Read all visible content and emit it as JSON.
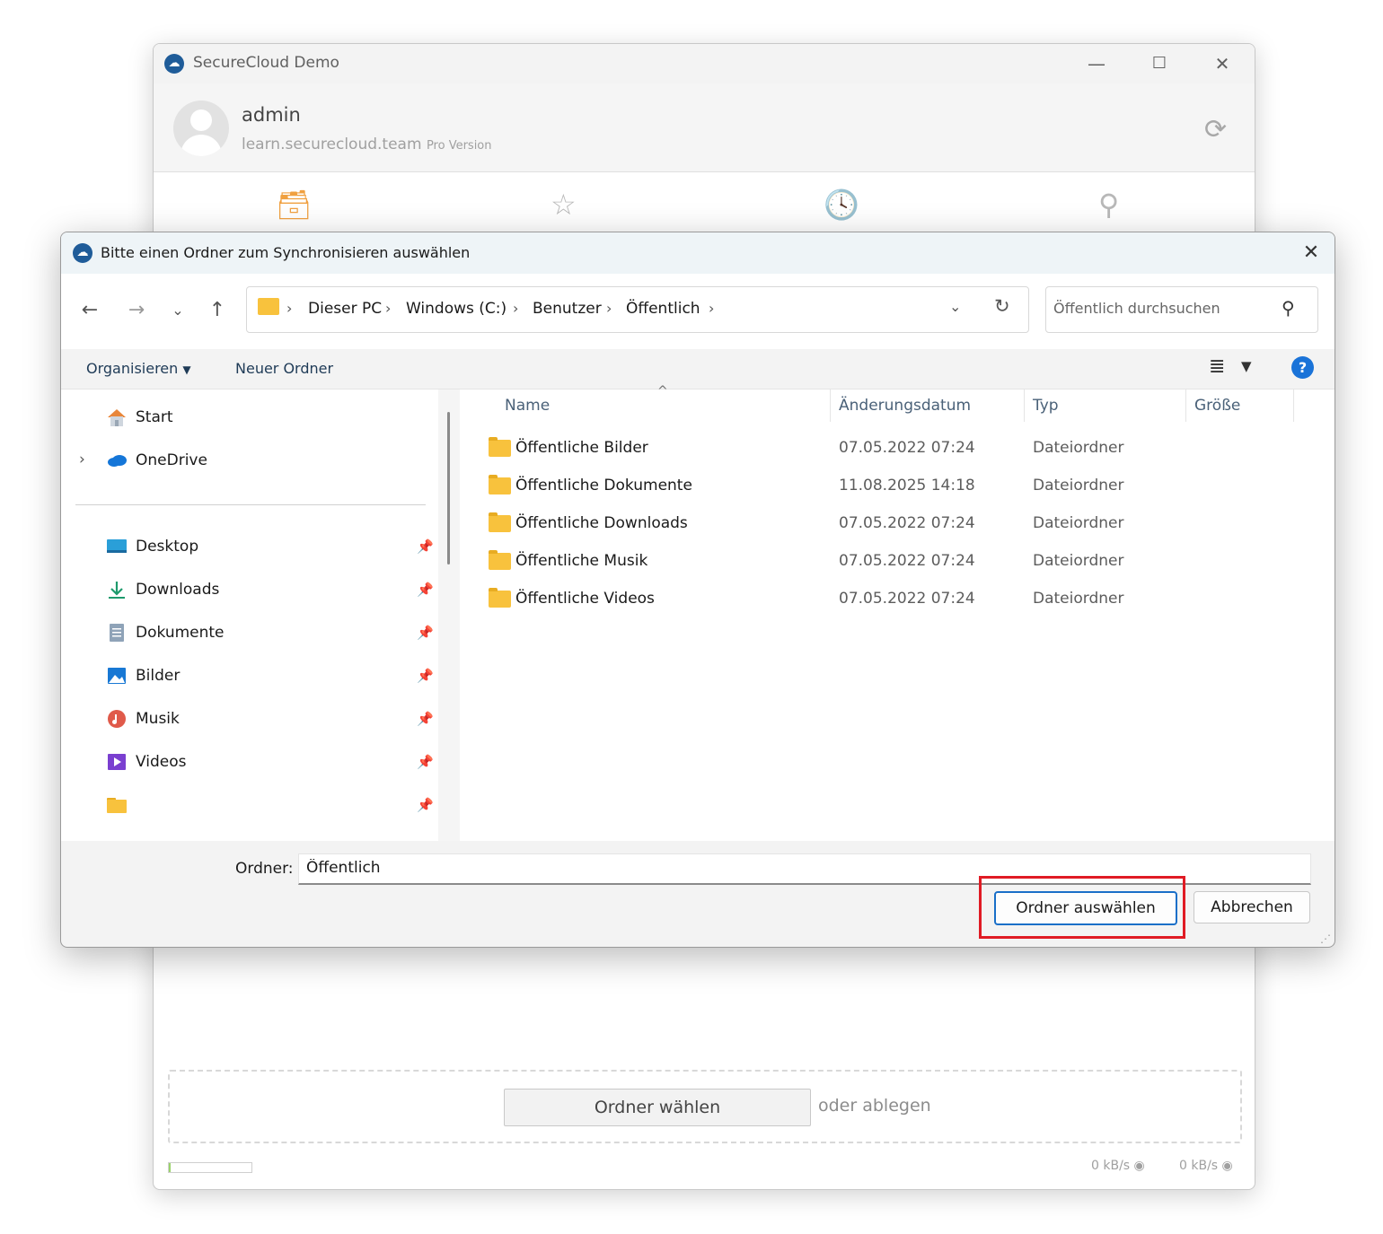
{
  "app": {
    "title": "SecureCloud Demo",
    "logo": "securecloud-logo",
    "window_controls": {
      "minimize": "—",
      "maximize": "☐",
      "close": "✕"
    },
    "user": {
      "name": "admin",
      "server": "learn.securecloud.team",
      "edition": "Pro Version"
    },
    "sync_icon": "sync-icon",
    "tabs": [
      "inbox-icon",
      "star-icon",
      "history-icon",
      "search-icon"
    ],
    "dropzone": {
      "button_label": "Ordner wählen",
      "drop_label": "oder ablegen"
    },
    "progress_fraction": 0.02,
    "speeds": {
      "upload": "0 kB/s",
      "download": "0 kB/s"
    }
  },
  "dialog": {
    "title": "Bitte einen Ordner zum Synchronisieren auswählen",
    "breadcrumb": [
      "Dieser PC",
      "Windows (C:)",
      "Benutzer",
      "Öffentlich"
    ],
    "search_placeholder": "Öffentlich durchsuchen",
    "toolbar": {
      "organize": "Organisieren",
      "new_folder": "Neuer Ordner"
    },
    "nav": {
      "top_items": [
        {
          "label": "Start",
          "icon": "home-icon"
        },
        {
          "label": "OneDrive",
          "icon": "cloud-icon"
        }
      ],
      "pinned_items": [
        {
          "label": "Desktop",
          "icon": "desktop-icon"
        },
        {
          "label": "Downloads",
          "icon": "download-icon"
        },
        {
          "label": "Dokumente",
          "icon": "document-icon"
        },
        {
          "label": "Bilder",
          "icon": "pictures-icon"
        },
        {
          "label": "Musik",
          "icon": "music-icon"
        },
        {
          "label": "Videos",
          "icon": "video-icon"
        },
        {
          "label": "",
          "icon": "folder-icon"
        }
      ]
    },
    "columns": [
      "Name",
      "Änderungsdatum",
      "Typ",
      "Größe"
    ],
    "files": [
      {
        "name": "Öffentliche Bilder",
        "date": "07.05.2022 07:24",
        "type": "Dateiordner"
      },
      {
        "name": "Öffentliche Dokumente",
        "date": "11.08.2025 14:18",
        "type": "Dateiordner"
      },
      {
        "name": "Öffentliche Downloads",
        "date": "07.05.2022 07:24",
        "type": "Dateiordner"
      },
      {
        "name": "Öffentliche Musik",
        "date": "07.05.2022 07:24",
        "type": "Dateiordner"
      },
      {
        "name": "Öffentliche Videos",
        "date": "07.05.2022 07:24",
        "type": "Dateiordner"
      }
    ],
    "folder_label": "Ordner:",
    "folder_value": "Öffentlich",
    "select_button": "Ordner auswählen",
    "cancel_button": "Abbrechen"
  },
  "colors": {
    "accent": "#1a6fc8",
    "highlight": "#e01b24",
    "folder": "#f8c23d",
    "inbox_tab": "#f0a040"
  }
}
